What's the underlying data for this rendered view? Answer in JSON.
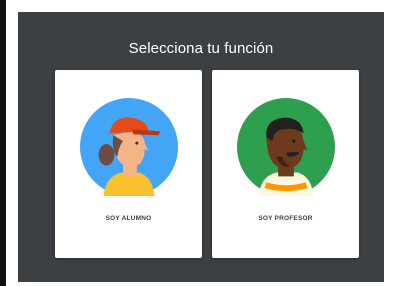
{
  "dialog": {
    "title": "Selecciona tu función"
  },
  "roles": [
    {
      "label": "SOY ALUMNO",
      "avatar_color": "#42a5f5",
      "icon": "student-avatar-icon"
    },
    {
      "label": "SOY PROFESOR",
      "avatar_color": "#2e9e4f",
      "icon": "teacher-avatar-icon"
    }
  ],
  "colors": {
    "panel_background": "#3c4043",
    "card_background": "#ffffff"
  }
}
